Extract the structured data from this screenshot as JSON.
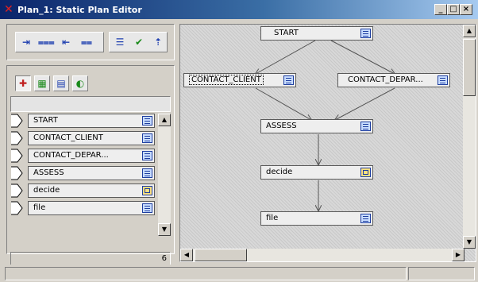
{
  "window": {
    "title": "Plan_1: Static Plan Editor",
    "icon": "x-close-red-icon",
    "buttons": [
      "_",
      "□",
      "×"
    ]
  },
  "toolbar": {
    "group1": [
      "step-in-icon",
      "collapse-icon",
      "step-out-icon",
      "expand-icon"
    ],
    "group2": [
      "list-icon",
      "check-icon",
      "sort-up-icon"
    ]
  },
  "tabs": [
    "tree-view-icon",
    "grid-view-icon",
    "list-view-icon",
    "toggle-view-icon"
  ],
  "list": {
    "items": [
      "START",
      "CONTACT_CLIENT",
      "CONTACT_DEPAR...",
      "ASSESS",
      "decide",
      "file"
    ],
    "count": "6"
  },
  "diagram": {
    "nodes": [
      {
        "id": "start",
        "label": "START",
        "type": "step"
      },
      {
        "id": "contact_client",
        "label": "CONTACT_CLIENT",
        "type": "step"
      },
      {
        "id": "contact_depar",
        "label": "CONTACT_DEPAR...",
        "type": "step"
      },
      {
        "id": "assess",
        "label": "ASSESS",
        "type": "step"
      },
      {
        "id": "decide",
        "label": "decide",
        "type": "decision"
      },
      {
        "id": "file",
        "label": "file",
        "type": "step"
      }
    ],
    "edges": [
      [
        "start",
        "contact_client"
      ],
      [
        "start",
        "contact_depar"
      ],
      [
        "contact_client",
        "assess"
      ],
      [
        "contact_depar",
        "assess"
      ],
      [
        "assess",
        "decide"
      ],
      [
        "decide",
        "file"
      ]
    ]
  },
  "colors": {
    "titlebar_start": "#0a246a",
    "titlebar_end": "#a6caf0",
    "node_icon_border": "#1e3ea0",
    "decision_fill": "#ffe080"
  }
}
